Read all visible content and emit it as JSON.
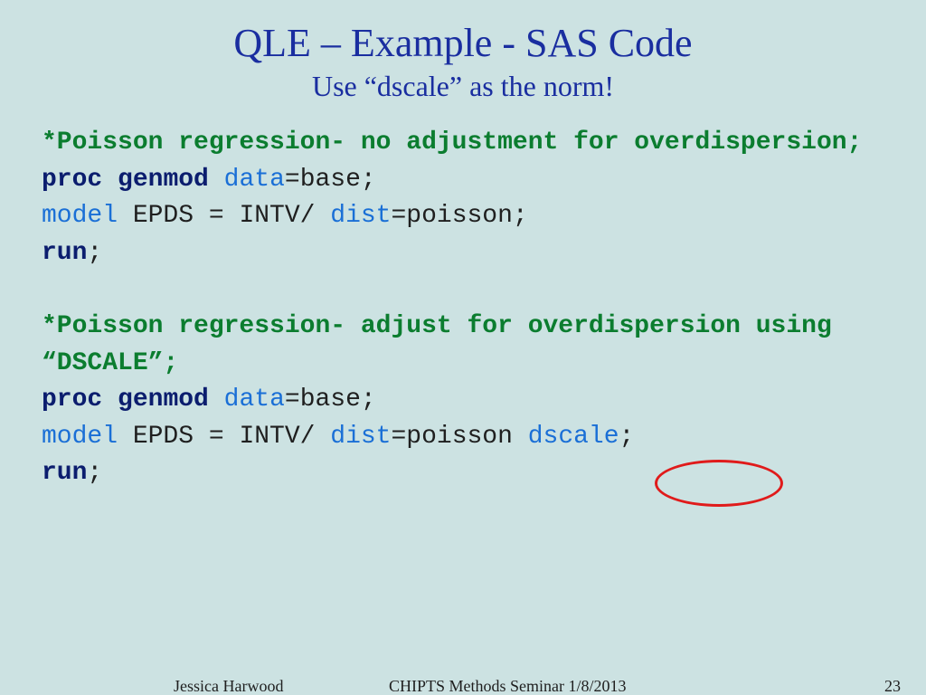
{
  "title": "QLE – Example - SAS Code",
  "subtitle": "Use “dscale” as the norm!",
  "code": {
    "comment1": "*Poisson regression- no adjustment for overdispersion;",
    "proc": "proc",
    "genmod": "genmod",
    "data": "data",
    "eq_base": "=base;",
    "model": "model",
    "model_eq": " EPDS = INTV/ ",
    "dist": "dist",
    "eq_poisson": "=poisson;",
    "eq_poisson_sp": "=poisson ",
    "run": "run",
    "semi": ";",
    "comment2": "*Poisson regression- adjust for overdispersion using “DSCALE”;",
    "dscale": "dscale"
  },
  "footer": {
    "author": "Jessica Harwood",
    "seminar": "CHIPTS Methods Seminar 1/8/2013",
    "page": "23"
  }
}
